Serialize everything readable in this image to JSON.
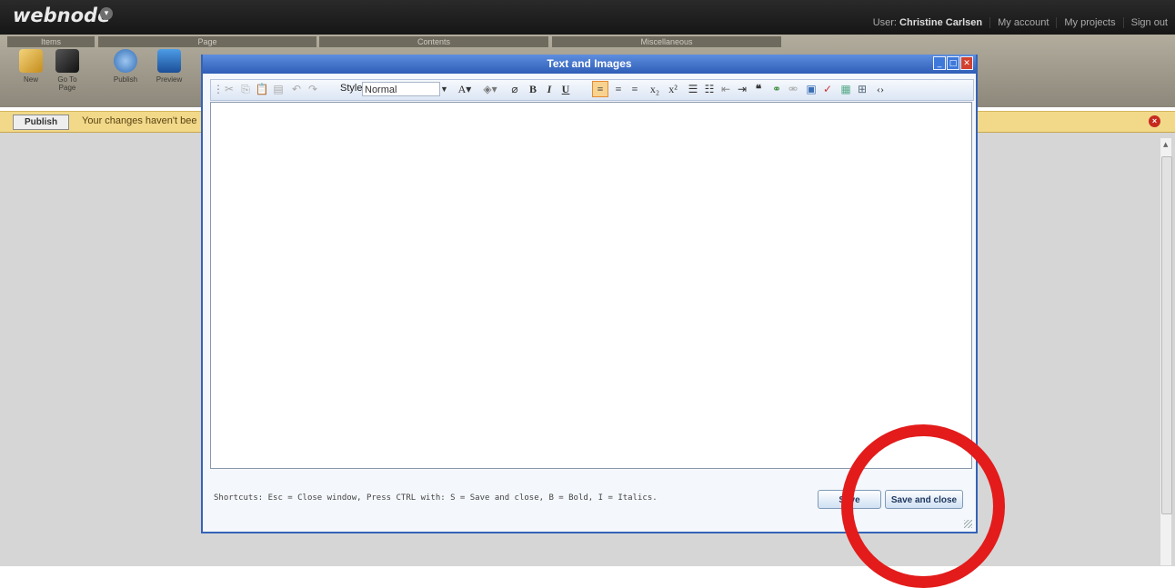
{
  "app": {
    "logo": "webnode",
    "logo_caret": "▾",
    "user_label": "User:",
    "user_name": "Christine Carlsen",
    "links": [
      "My account",
      "My projects",
      "Sign out"
    ]
  },
  "ribbon": {
    "groups": [
      "Items",
      "Page",
      "Contents",
      "Miscellaneous"
    ],
    "buttons": [
      {
        "label": "New",
        "icon": "pencil-icon"
      },
      {
        "label": "Go To Page",
        "icon": "feather-icon"
      },
      {
        "label": "Publish",
        "icon": "publish-icon"
      },
      {
        "label": "Preview",
        "icon": "monitor-icon"
      }
    ]
  },
  "notice": {
    "publish_label": "Publish",
    "text": "Your changes haven't bee",
    "close_icon": "close-icon"
  },
  "dialog": {
    "title": "Text and Images",
    "toolbar": {
      "style_label": "Style",
      "style_value": "Normal",
      "icons": [
        "cut-icon",
        "copy-icon",
        "paste-icon",
        "paste-text-icon",
        "undo-icon",
        "redo-icon",
        "font-color-icon",
        "bg-color-icon",
        "eraser-icon",
        "bold-icon",
        "italic-icon",
        "underline-icon",
        "align-left-icon",
        "align-center-icon",
        "align-right-icon",
        "subscript-icon",
        "superscript-icon",
        "ordered-list-icon",
        "unordered-list-icon",
        "outdent-icon",
        "indent-icon",
        "blockquote-icon",
        "link-icon",
        "unlink-icon",
        "image-icon",
        "spellcheck-icon",
        "media-icon",
        "table-icon",
        "source-icon"
      ]
    },
    "shortcuts": "Shortcuts: Esc = Close window, Press CTRL with: S = Save and close, B = Bold, I = Italics.",
    "save_label": "Save",
    "save_close_label": "Save and close"
  },
  "colors": {
    "annotation": "#e31b1b",
    "title_bar": "#3463b8",
    "notice": "#f2d98a"
  }
}
